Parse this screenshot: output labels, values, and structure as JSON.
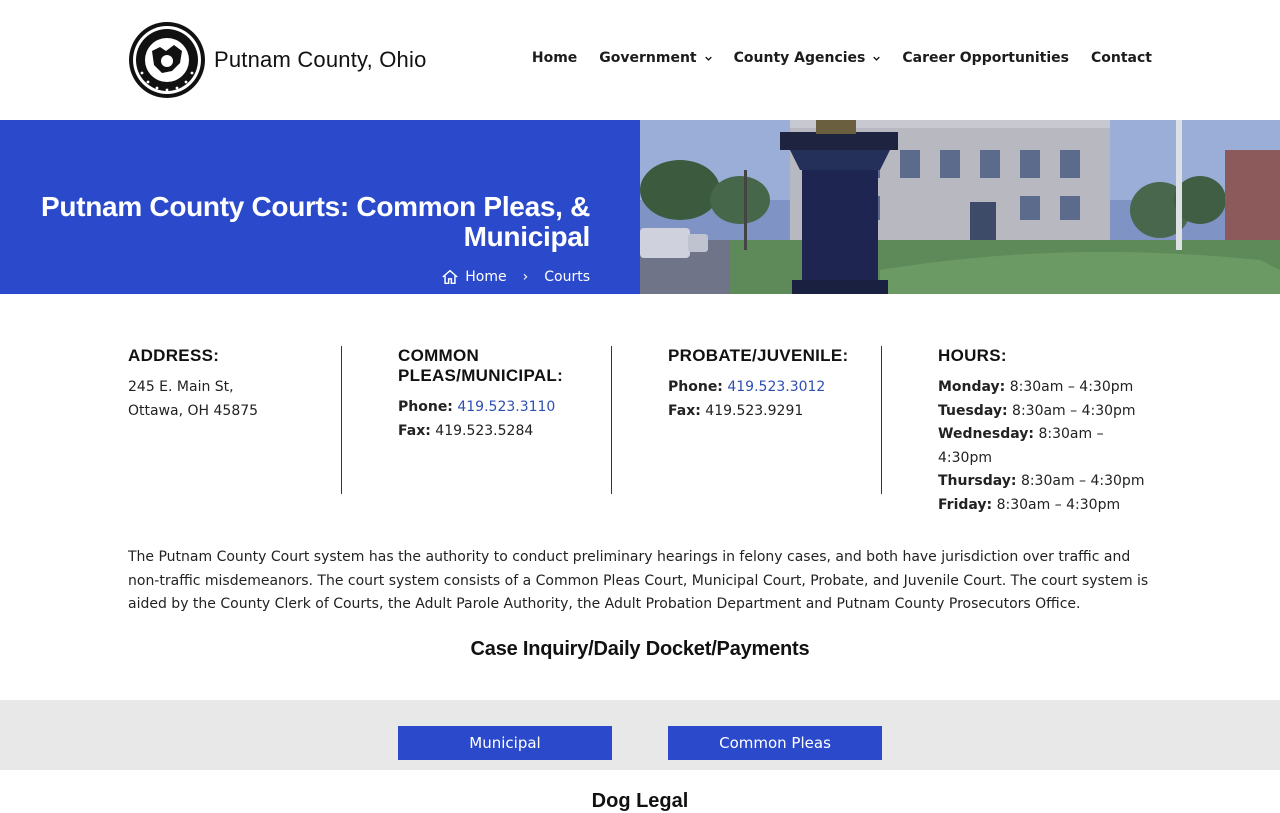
{
  "site": {
    "title": "Putnam County, Ohio"
  },
  "nav": {
    "items": [
      {
        "label": "Home",
        "dropdown": false
      },
      {
        "label": "Government",
        "dropdown": true
      },
      {
        "label": "County Agencies",
        "dropdown": true
      },
      {
        "label": "Career Opportunities",
        "dropdown": false
      },
      {
        "label": "Contact",
        "dropdown": false
      }
    ]
  },
  "hero": {
    "title": "Putnam County Courts: Common Pleas, & Municipal",
    "breadcrumb": {
      "home": "Home",
      "separator": "›",
      "current": "Courts"
    }
  },
  "info": {
    "address": {
      "heading": "ADDRESS:",
      "line1": "245 E. Main St,",
      "line2": "Ottawa, OH 45875"
    },
    "common_pleas": {
      "heading": "COMMON PLEAS/MUNICIPAL:",
      "phone_label": "Phone:",
      "phone": "419.523.3110",
      "fax_label": "Fax:",
      "fax": "419.523.5284"
    },
    "probate": {
      "heading": "PROBATE/JUVENILE:",
      "phone_label": "Phone:",
      "phone": "419.523.3012",
      "fax_label": "Fax:",
      "fax": "419.523.9291"
    },
    "hours": {
      "heading": "HOURS:",
      "days": [
        {
          "day": "Monday:",
          "time": "8:30am – 4:30pm"
        },
        {
          "day": "Tuesday:",
          "time": "8:30am – 4:30pm"
        },
        {
          "day": "Wednesday:",
          "time": "8:30am – 4:30pm"
        },
        {
          "day": "Thursday:",
          "time": "8:30am – 4:30pm"
        },
        {
          "day": "Friday:",
          "time": "8:30am – 4:30pm"
        }
      ]
    }
  },
  "description": "The Putnam County Court system has the authority to conduct preliminary hearings in felony cases, and both have jurisdiction over traffic and non-traffic misdemeanors. The court system consists of a Common Pleas Court, Municipal Court, Probate, and Juvenile Court. The court system is aided by the County Clerk of Courts, the Adult Parole Authority, the Adult Probation Department and Putnam County Prosecutors Office.",
  "case_inquiry": {
    "heading": "Case Inquiry/Daily Docket/Payments",
    "buttons": {
      "municipal": "Municipal",
      "common_pleas": "Common Pleas"
    }
  },
  "next_section": {
    "heading": "Dog Legal"
  },
  "colors": {
    "primary": "#2b4acb",
    "link": "#2e4fb0",
    "band": "#e8e8e8"
  }
}
